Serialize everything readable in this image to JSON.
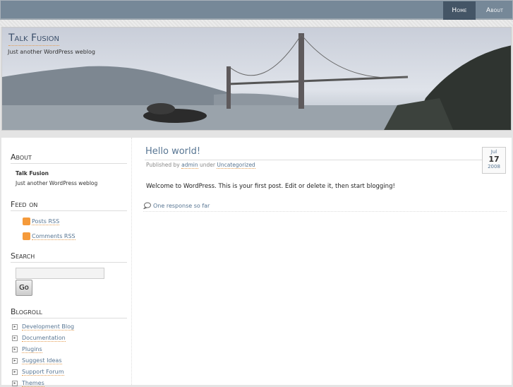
{
  "nav": {
    "items": [
      {
        "label": "Home"
      },
      {
        "label": "About"
      }
    ]
  },
  "header": {
    "title": "Talk Fusion",
    "tagline": "Just another WordPress weblog"
  },
  "sidebar": {
    "about": {
      "heading": "About",
      "name": "Talk Fusion",
      "text": "Just another WordPress weblog"
    },
    "feed": {
      "heading": "Feed on",
      "items": [
        "Posts RSS",
        "Comments RSS"
      ]
    },
    "search": {
      "heading": "Search",
      "value": "",
      "button": "Go"
    },
    "blogroll": {
      "heading": "Blogroll",
      "items": [
        "Development Blog",
        "Documentation",
        "Plugins",
        "Suggest Ideas",
        "Support Forum",
        "Themes"
      ]
    }
  },
  "post": {
    "title": "Hello world!",
    "published_by": "Published by",
    "author": "admin",
    "under": "under",
    "category": "Uncategorized",
    "date": {
      "month": "Jul",
      "day": "17",
      "year": "2008"
    },
    "body": "Welcome to WordPress. This is your first post. Edit or delete it, then start blogging!",
    "responses": "One response so far"
  }
}
